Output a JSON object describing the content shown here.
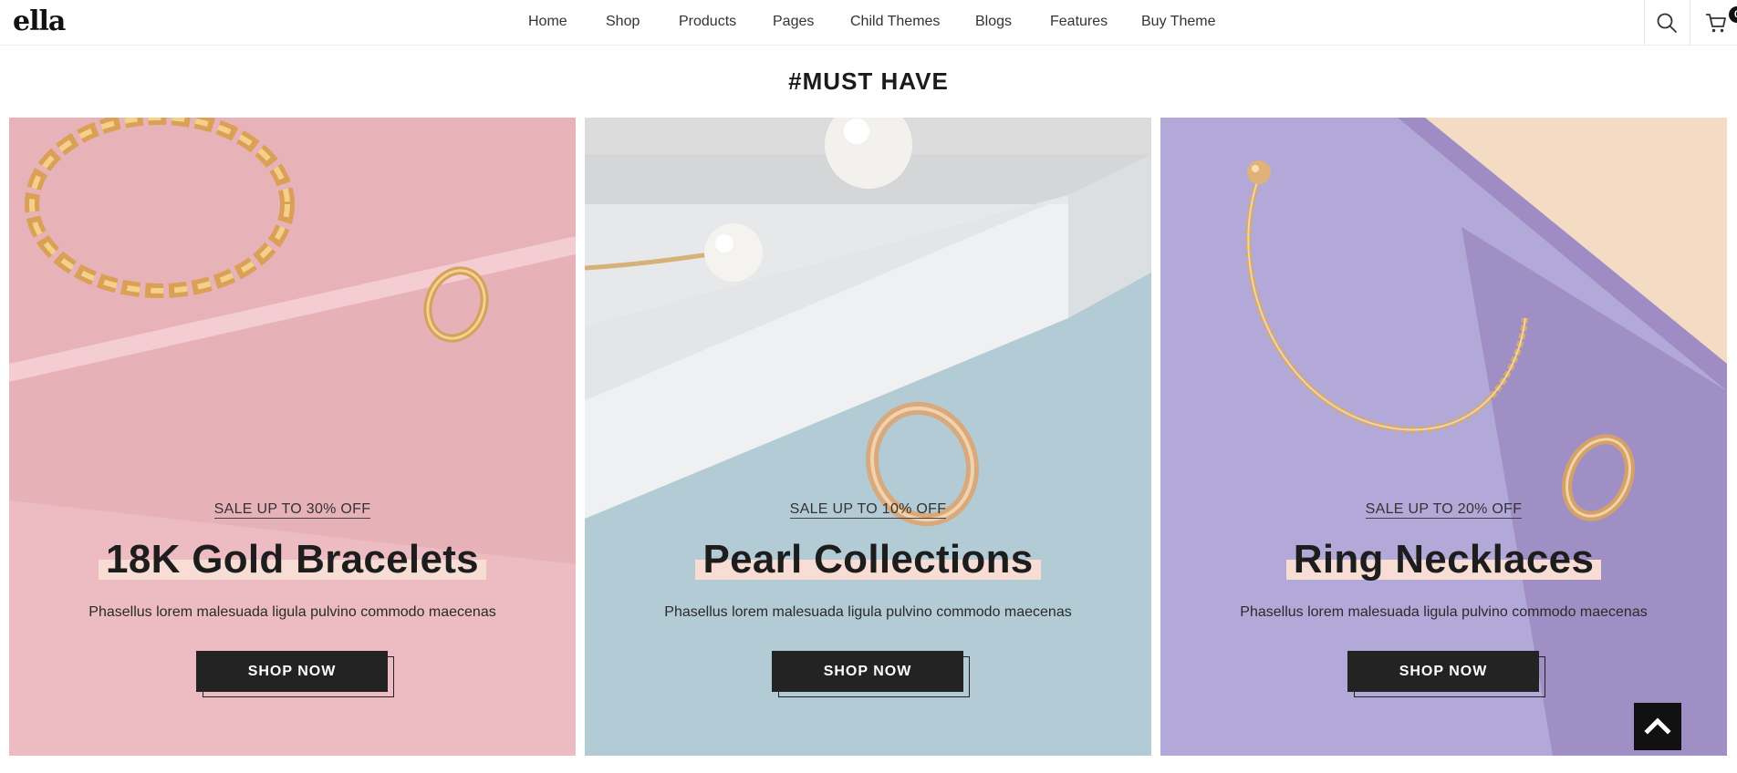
{
  "brand": {
    "logo": "ella"
  },
  "nav": {
    "items": [
      "Home",
      "Shop",
      "Products",
      "Pages",
      "Child Themes",
      "Blogs",
      "Features",
      "Buy Theme"
    ]
  },
  "header_icons": {
    "search": "search-icon",
    "cart": "cart-icon",
    "cart_count": "0"
  },
  "section": {
    "title": "#MUST HAVE"
  },
  "cards": [
    {
      "sale": "SALE UP TO 30% OFF",
      "title": "18K Gold Bracelets",
      "description": "Phasellus lorem malesuada ligula pulvino commodo maecenas",
      "button": "SHOP NOW",
      "bg_color": "#e9b7bd"
    },
    {
      "sale": "SALE UP TO 10% OFF",
      "title": "Pearl Collections",
      "description": "Phasellus lorem malesuada ligula pulvino commodo maecenas",
      "button": "SHOP NOW",
      "bg_color": "#b6ccd6"
    },
    {
      "sale": "SALE UP TO 20% OFF",
      "title": "Ring Necklaces",
      "description": "Phasellus lorem malesuada ligula pulvino commodo maecenas",
      "button": "SHOP NOW",
      "bg_color": "#b4a9d9"
    }
  ],
  "colors": {
    "button_bg": "#232323",
    "title_highlight": "#f7ddd4",
    "back_to_top": "#111111"
  }
}
